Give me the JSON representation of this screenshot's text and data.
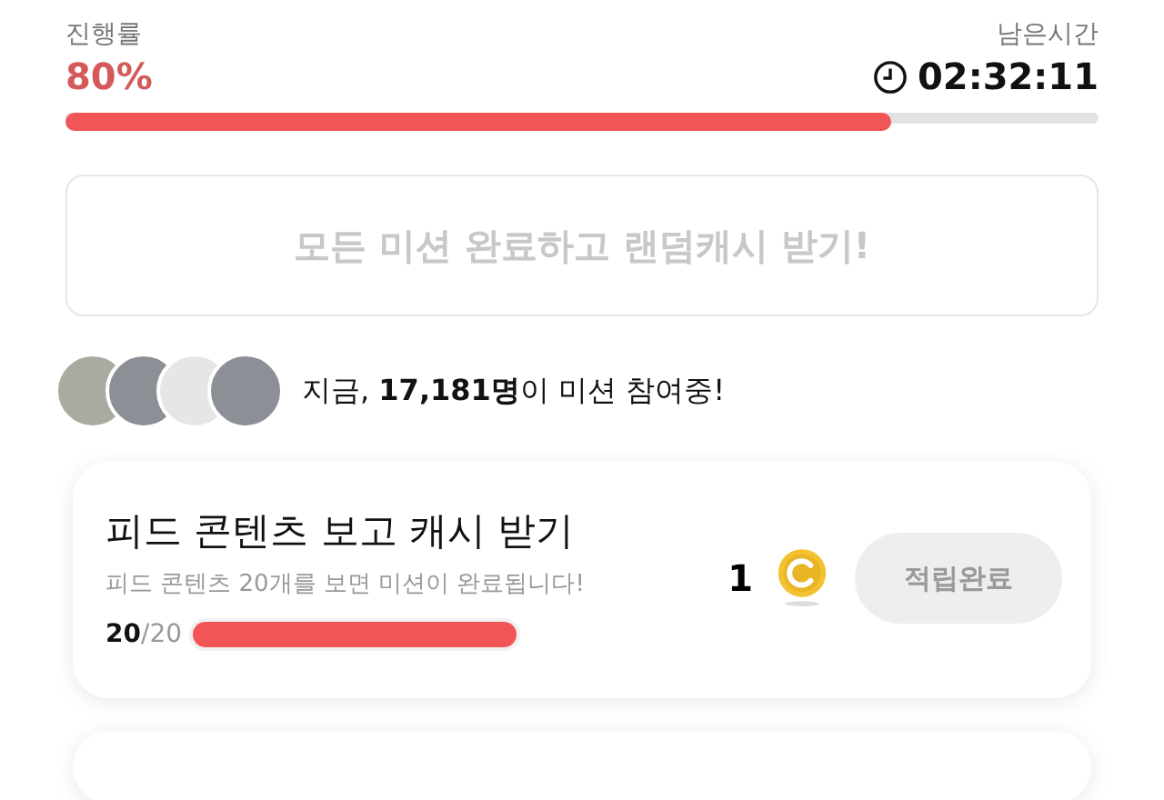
{
  "progress": {
    "label": "진행률",
    "value": "80%",
    "level": 0.8
  },
  "timer": {
    "label": "남은시간",
    "value": "02:32:11"
  },
  "all_missions_button": {
    "label": "모든 미션 완료하고 랜덤캐시 받기!",
    "disabled": true
  },
  "participants": {
    "avatars": [
      {
        "kind": "photo"
      },
      {
        "kind": "photo"
      },
      {
        "kind": "blank"
      },
      {
        "kind": "photo"
      }
    ],
    "text": "지금, **17,181명**이 미션 참여중!"
  },
  "missions": [
    {
      "title": "피드 콘텐츠 보고 캐시 받기",
      "description": "피드 콘텐츠 20개를 보면 미션이 완료됩니다!",
      "done": "20",
      "total": "/20",
      "level": 1,
      "reward": "1",
      "button": "적립완료",
      "disabled": true
    }
  ]
}
